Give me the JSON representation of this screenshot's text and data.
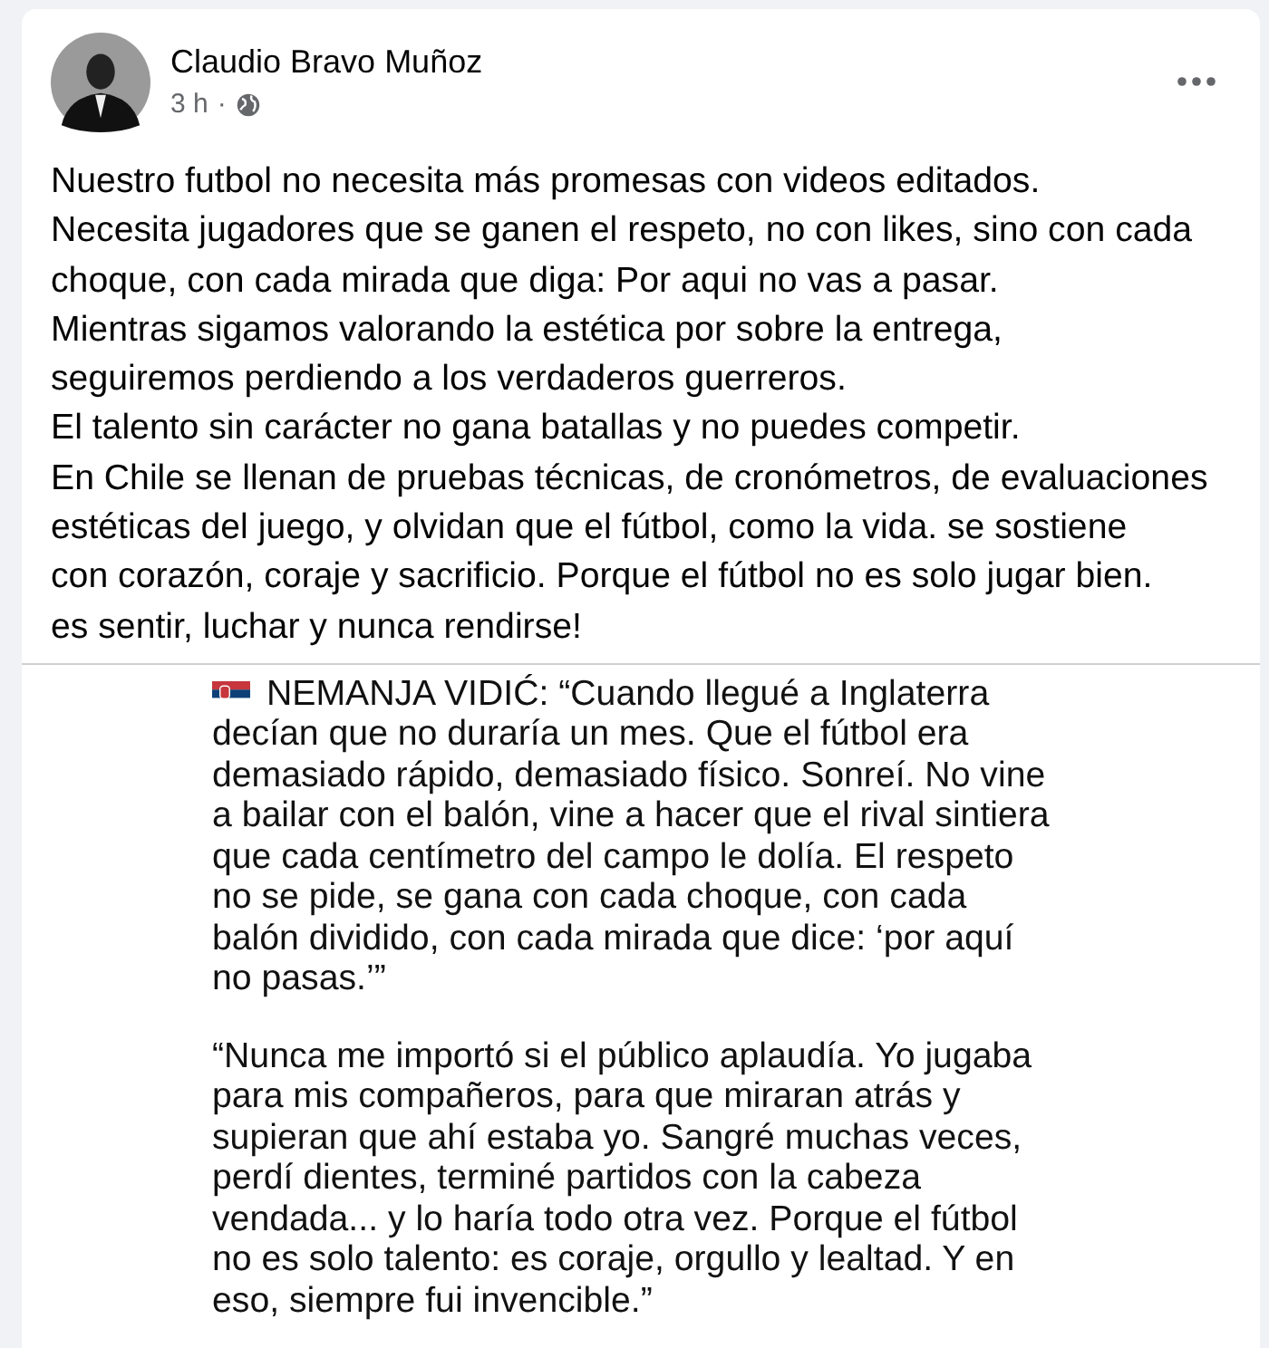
{
  "post": {
    "author": "Claudio Bravo Muñoz",
    "time": "3 h",
    "separator": "·",
    "text_lines": [
      "Nuestro futbol no necesita más promesas con videos editados.",
      "Necesita jugadores que se ganen el respeto, no con likes, sino con cada",
      "choque, con cada mirada que diga: Por aqui no vas a pasar.",
      "Mientras sigamos valorando la estética por sobre la entrega,",
      "seguiremos perdiendo a los verdaderos guerreros.",
      "El talento sin carácter no gana batallas y no puedes competir.",
      "En Chile se llenan de pruebas técnicas, de cronómetros, de evaluaciones",
      "estéticas del juego, y olvidan que el fútbol, como la vida. se sostiene",
      "con corazón, coraje y sacrificio. Porque el fútbol no es solo jugar bien.",
      "es sentir, luchar y nunca rendirse!"
    ]
  },
  "shared_image": {
    "paragraphs": [
      {
        "lines": [
          "NEMANJA VIDIĆ: “Cuando llegué a Inglaterra",
          "decían que no duraría un mes. Que el fútbol era",
          "demasiado rápido, demasiado físico. Sonreí. No vine",
          "a bailar con el balón, vine a hacer que el rival sintiera",
          "que cada centímetro del campo le dolía. El respeto",
          "no se pide, se gana con cada choque, con cada",
          "balón dividido, con cada mirada que dice: ‘por aquí",
          "no pasas.’”"
        ]
      },
      {
        "lines": [
          "“Nunca me importó si el público aplaudía. Yo jugaba",
          "para mis compañeros, para que miraran atrás y",
          "supieran que ahí estaba yo. Sangré muchas veces,",
          "perdí dientes, terminé partidos con la cabeza",
          "vendada... y lo haría todo otra vez. Porque el fútbol",
          "no es solo talento: es coraje, orgullo y lealtad. Y en",
          "eso, siempre fui invencible.”"
        ]
      }
    ]
  }
}
